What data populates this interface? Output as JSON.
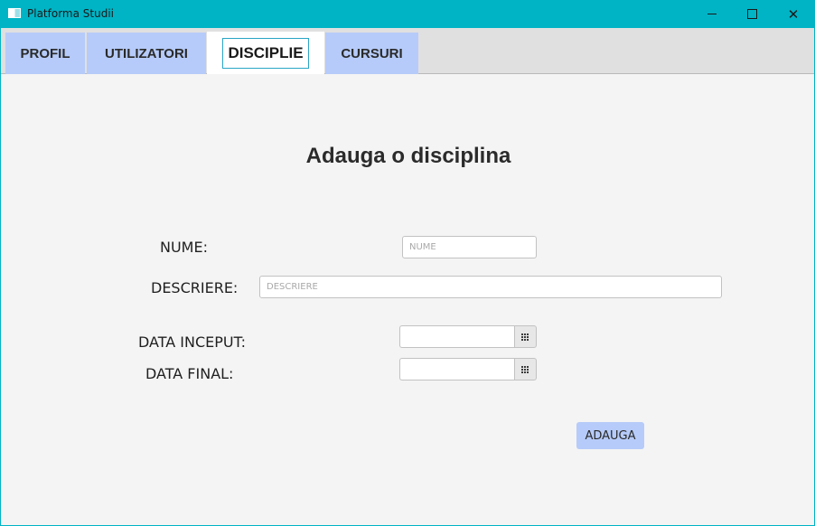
{
  "window": {
    "title": "Platforma Studii",
    "minimize_symbol": "",
    "close_symbol": "✕"
  },
  "tabs": [
    {
      "label": "PROFIL",
      "selected": false
    },
    {
      "label": "UTILIZATORI",
      "selected": false
    },
    {
      "label": "DISCIPLIE",
      "selected": true
    },
    {
      "label": "CURSURI",
      "selected": false
    }
  ],
  "form": {
    "heading": "Adauga o disciplina",
    "nume_label": "NUME:",
    "nume_placeholder": "NUME",
    "nume_value": "",
    "descriere_label": "DESCRIERE:",
    "descriere_placeholder": "DESCRIERE",
    "descriere_value": "",
    "data_inceput_label": "DATA INCEPUT:",
    "data_inceput_value": "",
    "data_final_label": "DATA FINAL:",
    "data_final_value": "",
    "submit_label": "ADAUGA"
  },
  "colors": {
    "title_bar": "#00b4c5",
    "tab_background": "#b6cbf9",
    "tab_selected": "#ffffff",
    "content_background": "#f4f4f4",
    "button_background": "#b6cbf9",
    "focus_border": "#2aa6c6"
  },
  "icons": {
    "app": "window-app-icon",
    "minimize": "minimize-icon",
    "maximize": "maximize-icon",
    "close": "close-icon",
    "calendar": "calendar-icon"
  }
}
